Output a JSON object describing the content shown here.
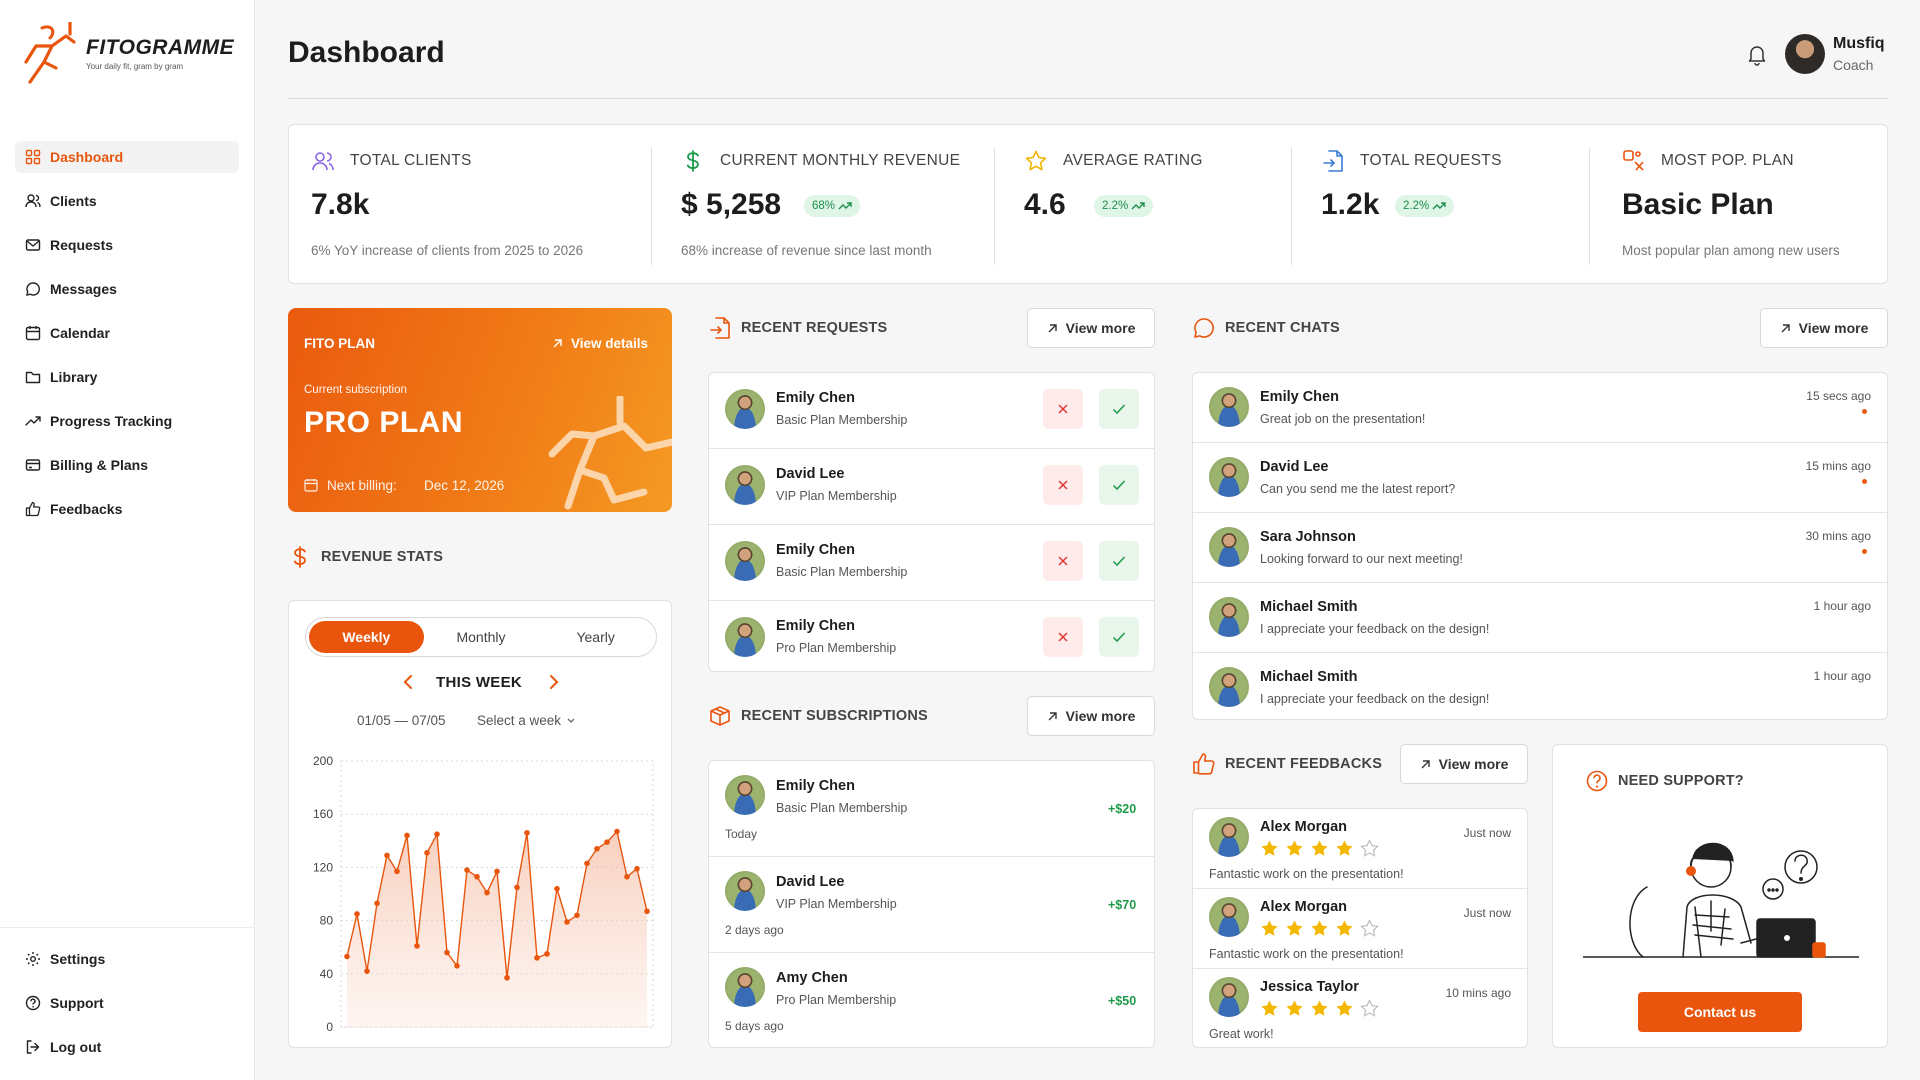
{
  "brand": {
    "name": "FITOGRAMME",
    "tagline": "Your daily fit, gram by gram",
    "accent": "#E9550D"
  },
  "sidebar": {
    "items": [
      {
        "label": "Dashboard",
        "icon": "grid-icon",
        "active": true
      },
      {
        "label": "Clients",
        "icon": "users-icon"
      },
      {
        "label": "Requests",
        "icon": "mail-icon"
      },
      {
        "label": "Messages",
        "icon": "chat-icon"
      },
      {
        "label": "Calendar",
        "icon": "calendar-icon"
      },
      {
        "label": "Library",
        "icon": "folder-icon"
      },
      {
        "label": "Progress Tracking",
        "icon": "trend-icon"
      },
      {
        "label": "Billing & Plans",
        "icon": "card-icon"
      },
      {
        "label": "Feedbacks",
        "icon": "thumbs-up-icon"
      }
    ],
    "bottom": [
      {
        "label": "Settings",
        "icon": "gear-icon"
      },
      {
        "label": "Support",
        "icon": "help-icon"
      },
      {
        "label": "Log out",
        "icon": "logout-icon"
      }
    ]
  },
  "header": {
    "title": "Dashboard",
    "user": {
      "name": "Musfiq",
      "role": "Coach"
    }
  },
  "stats": [
    {
      "label": "TOTAL CLIENTS",
      "value": "7.8k",
      "badge": "",
      "sub": "6% YoY increase of clients from 2025 to 2026"
    },
    {
      "label": "CURRENT MONTHLY REVENUE",
      "value": "$ 5,258",
      "badge": "68%",
      "sub": "68% increase of revenue since last month"
    },
    {
      "label": "AVERAGE  RATING",
      "value": "4.6",
      "badge": "2.2%",
      "sub": ""
    },
    {
      "label": "TOTAL REQUESTS",
      "value": "1.2k",
      "badge": "2.2%",
      "sub": ""
    },
    {
      "label": "MOST POP. PLAN",
      "value": "Basic Plan",
      "badge": "",
      "sub": "Most popular plan among new users"
    }
  ],
  "plan": {
    "title": "FITO PLAN",
    "view_details": "View details",
    "current_label": "Current subscription",
    "name": "PRO PLAN",
    "billing_label": "Next billing:",
    "billing_date": "Dec 12, 2026"
  },
  "revenue": {
    "title": "REVENUE STATS",
    "tabs": [
      "Weekly",
      "Monthly",
      "Yearly"
    ],
    "active_tab": "Weekly",
    "period": "THIS WEEK",
    "range": "01/05 — 07/05",
    "select": "Select a week"
  },
  "chart_data": {
    "type": "area",
    "title": "",
    "ylim": [
      0,
      200
    ],
    "yticks": [
      0,
      40,
      80,
      120,
      160,
      200
    ],
    "grid": true,
    "color": "#E9550D",
    "values": [
      53,
      85,
      42,
      93,
      129,
      117,
      144,
      61,
      131,
      145,
      56,
      46,
      118,
      113,
      101,
      117,
      37,
      105,
      146,
      52,
      55,
      104,
      79,
      84,
      123,
      134,
      139,
      147,
      113,
      119,
      87
    ]
  },
  "requests": {
    "title": "RECENT REQUESTS",
    "view_more": "View more",
    "items": [
      {
        "name": "Emily Chen",
        "plan": "Basic Plan Membership"
      },
      {
        "name": "David Lee",
        "plan": "VIP Plan Membership"
      },
      {
        "name": "Emily Chen",
        "plan": "Basic Plan Membership"
      },
      {
        "name": "Emily Chen",
        "plan": "Pro Plan Membership"
      }
    ]
  },
  "subscriptions": {
    "title": "RECENT SUBSCRIPTIONS",
    "view_more": "View more",
    "items": [
      {
        "name": "Emily Chen",
        "plan": "Basic Plan Membership",
        "amount": "+$20",
        "time": "Today"
      },
      {
        "name": "David Lee",
        "plan": "VIP Plan Membership",
        "amount": "+$70",
        "time": "2 days ago"
      },
      {
        "name": "Amy Chen",
        "plan": "Pro Plan Membership",
        "amount": "+$50",
        "time": "5 days ago"
      }
    ]
  },
  "chats": {
    "title": "RECENT CHATS",
    "view_more": "View more",
    "items": [
      {
        "name": "Emily Chen",
        "message": "Great job on the presentation!",
        "time": "15 secs ago",
        "unread": true
      },
      {
        "name": "David Lee",
        "message": "Can you send me the latest report?",
        "time": "15 mins ago",
        "unread": true
      },
      {
        "name": "Sara Johnson",
        "message": "Looking forward to our next meeting!",
        "time": "30 mins ago",
        "unread": true
      },
      {
        "name": "Michael Smith",
        "message": "I appreciate your feedback on the design!",
        "time": "1 hour ago",
        "unread": false
      },
      {
        "name": "Michael Smith",
        "message": "I appreciate your feedback on the design!",
        "time": "1 hour ago",
        "unread": false
      }
    ]
  },
  "feedbacks": {
    "title": "RECENT FEEDBACKS",
    "view_more": "View more",
    "items": [
      {
        "name": "Alex Morgan",
        "rating": 4,
        "comment": "Fantastic work on the presentation!",
        "time": "Just now"
      },
      {
        "name": "Alex Morgan",
        "rating": 4,
        "comment": "Fantastic work on the presentation!",
        "time": "Just now"
      },
      {
        "name": "Jessica Taylor",
        "rating": 4,
        "comment": "Great work!",
        "time": "10 mins ago"
      }
    ]
  },
  "support": {
    "title": "NEED SUPPORT?",
    "button": "Contact us"
  }
}
